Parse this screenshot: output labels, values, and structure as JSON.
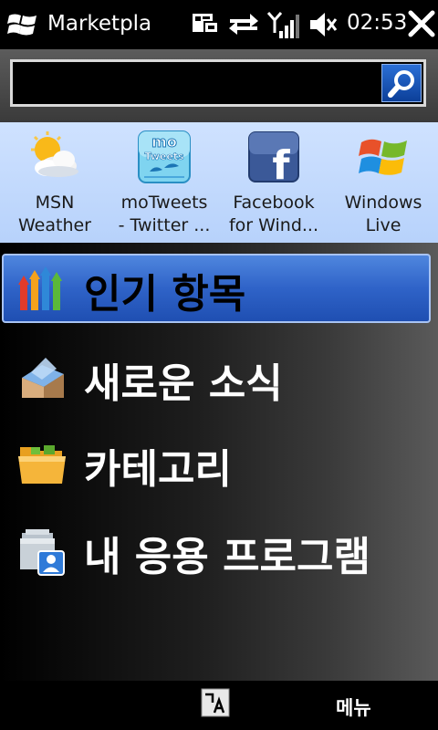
{
  "statusbar": {
    "title": "Marketpla",
    "time": "02:53"
  },
  "search": {
    "value": "",
    "placeholder": ""
  },
  "featured": [
    {
      "line1": "MSN",
      "line2": "Weather",
      "icon": "weather-icon"
    },
    {
      "line1": "moTweets",
      "line2": "- Twitter ...",
      "icon": "motweets-icon",
      "icon_text_1": "mo",
      "icon_text_2": "Tweets"
    },
    {
      "line1": "Facebook",
      "line2": "for Wind...",
      "icon": "facebook-icon",
      "icon_text": "f"
    },
    {
      "line1": "Windows",
      "line2": "Live",
      "icon": "windows-live-icon"
    }
  ],
  "menu": [
    {
      "label": "인기 항목",
      "icon": "popular-chart-icon",
      "selected": true
    },
    {
      "label": "새로운 소식",
      "icon": "new-box-icon",
      "selected": false
    },
    {
      "label": "카테고리",
      "icon": "folder-icon",
      "selected": false
    },
    {
      "label": "내 응용 프로그램",
      "icon": "my-apps-icon",
      "selected": false
    }
  ],
  "bottombar": {
    "menu_label": "메뉴",
    "kbd_icon": "input-method-icon"
  },
  "colors": {
    "accent": "#2f63c8",
    "featured_bg": "#c3dafd"
  }
}
